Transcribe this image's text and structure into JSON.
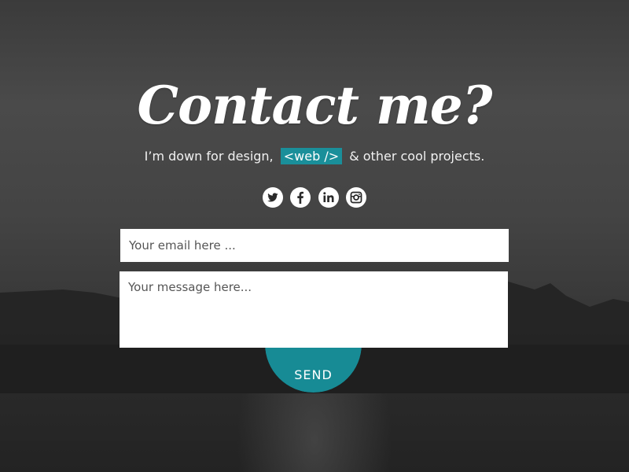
{
  "contact": {
    "title": "Contact me?",
    "subtitle_before": "I’m down for design,",
    "subtitle_highlight": "<web />",
    "subtitle_after": "& other cool projects.",
    "highlight_color": "#1a8f9a"
  },
  "socials": [
    {
      "name": "twitter",
      "icon": "twitter-icon"
    },
    {
      "name": "facebook",
      "icon": "facebook-icon"
    },
    {
      "name": "linkedin",
      "icon": "linkedin-icon"
    },
    {
      "name": "instagram",
      "icon": "instagram-icon"
    }
  ],
  "form": {
    "email_placeholder": "Your email here ...",
    "message_placeholder": "Your message here...",
    "send_label": "SEND",
    "send_color": "#178b95"
  }
}
